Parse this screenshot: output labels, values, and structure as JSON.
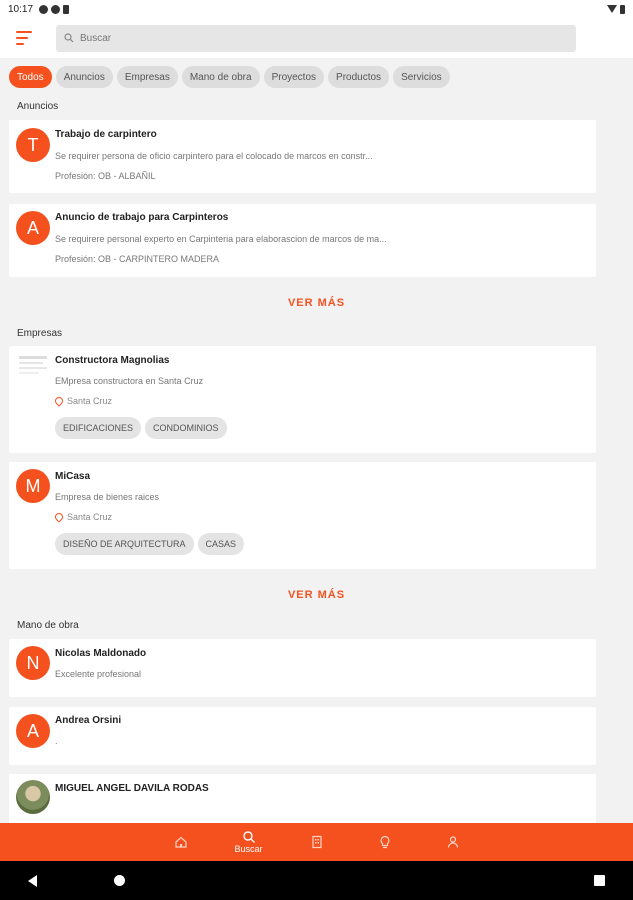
{
  "status": {
    "time": "10:17"
  },
  "search": {
    "placeholder": "Buscar"
  },
  "filters": [
    "Todos",
    "Anuncios",
    "Empresas",
    "Mano de obra",
    "Proyectos",
    "Productos",
    "Servicios"
  ],
  "sections": {
    "anuncios": {
      "title": "Anuncios",
      "items": [
        {
          "initial": "T",
          "title": "Trabajo de carpintero",
          "desc": "Se requirer persona de oficio carpintero para el colocado de marcos en constr...",
          "profession": "Profesión: OB - ALBAÑIL"
        },
        {
          "initial": "A",
          "title": "Anuncio de trabajo para Carpinteros",
          "desc": "Se requirere personal experto en Carpinteria para elaborascion de marcos de ma...",
          "profession": "Profesión: OB - CARPINTERO MADERA"
        }
      ],
      "more": "VER MÁS"
    },
    "empresas": {
      "title": "Empresas",
      "items": [
        {
          "initial": "",
          "title": "Constructora Magnolias",
          "desc": "EMpresa constructora en Santa Cruz",
          "location": "Santa Cruz",
          "tags": [
            "EDIFICACIONES",
            "CONDOMINIOS"
          ]
        },
        {
          "initial": "M",
          "title": "MiCasa",
          "desc": "Empresa de bienes raices",
          "location": "Santa Cruz",
          "tags": [
            "DISEÑO DE ARQUITECTURA",
            "CASAS"
          ]
        }
      ],
      "more": "VER MÁS"
    },
    "mano_de_obra": {
      "title": "Mano de obra",
      "items": [
        {
          "initial": "N",
          "title": "Nicolas Maldonado",
          "desc": "Excelente profesional"
        },
        {
          "initial": "A",
          "title": "Andrea Orsini",
          "desc": "."
        },
        {
          "initial": "",
          "title": "MIGUEL ANGEL  DAVILA RODAS",
          "desc": ""
        }
      ]
    }
  },
  "bottom_nav": {
    "search_label": "Buscar"
  },
  "colors": {
    "accent": "#f4511e"
  }
}
